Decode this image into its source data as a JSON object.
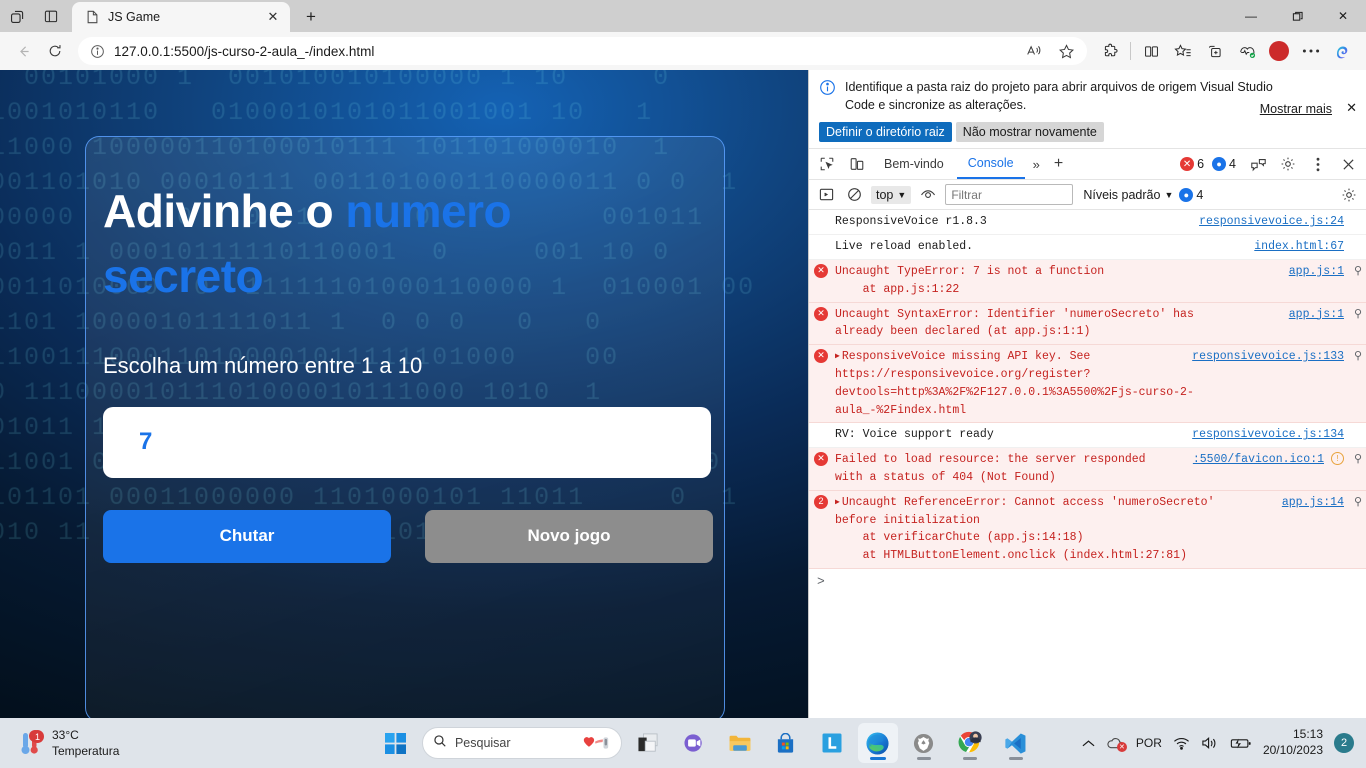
{
  "browser": {
    "tab": {
      "title": "JS Game",
      "favicon_icon": "page-icon",
      "close_icon": "close-icon"
    },
    "new_tab_label": "+",
    "tab_actions_icon": "tab-actions-icon",
    "tab_search_icon": "vertical-tabs-icon",
    "window_controls": {
      "minimize": "—",
      "maximize": "❐",
      "close": "✕"
    },
    "nav": {
      "back_icon": "back-arrow-icon",
      "reload_icon": "reload-icon",
      "url": "127.0.0.1:5500/js-curso-2-aula_-/index.html",
      "site_info_icon": "info-circle-icon",
      "read_aloud_icon": "read-aloud-icon",
      "favorite_icon": "star-icon",
      "extensions_icon": "puzzle-piece-icon",
      "split_screen_icon": "split-screen-icon",
      "collections_icon": "favorites-list-icon",
      "add_tab_group_icon": "browser-essentials-icon",
      "performance_icon": "browser-essentials-health-icon",
      "profile_icon": "profile-avatar-icon",
      "settings_more_icon": "more-options-icon",
      "copilot_icon": "copilot-icon"
    }
  },
  "game": {
    "title_part1": "Adivinhe o ",
    "title_accent": "numero secreto",
    "subtitle": "Escolha um número entre 1 a 10",
    "input_value": "7",
    "input_placeholder": "",
    "guess_button": "Chutar",
    "new_game_button": "Novo jogo",
    "accent_color": "#1a73e8",
    "secondary_color": "#8d8d8d",
    "binary_lines": [
      "  00101000 1  001010010100000 1 10     0",
      "1001010110   0100010101011001001 10   1",
      "11000 100000110100010111 101101000010  1",
      "001101010 00010111 001101000110000011 0 0  1",
      "00000      0   0  1      0          001011",
      "0011 1 00010111110110001  0     001 10 0",
      "0011010000  0  11111101000110000 1  010001 00",
      "1101 10000101111011 1  0 0 0   0   0",
      "1100111000110100001011111101000    00",
      "0 11100001011101000010111000 1010  1",
      "01011 1 0101110100010111 0100 1 0 10  11",
      "11001 00 01101 0001011001011000010 00     0",
      "101101 00011000000 1101000101 11011     0  1",
      "010 11 101101000 101100101 010 011000   0"
    ]
  },
  "devtools": {
    "banner": {
      "icon": "info-circle-icon",
      "text": "Identifique a pasta raiz do projeto para abrir arquivos de origem Visual Studio Code e sincronize as alterações.",
      "show_more": "Mostrar mais",
      "close_icon": "close-icon",
      "primary_button": "Definir o diretório raiz",
      "secondary_button": "Não mostrar novamente"
    },
    "toolbar": {
      "inspect_icon": "inspect-element-icon",
      "device_toggle_icon": "device-emulation-icon",
      "tabs": [
        {
          "label": "Bem-vindo",
          "active": false
        },
        {
          "label": "Console",
          "active": true
        }
      ],
      "more_tabs_icon": "chevron-double-right-icon",
      "add_tab_icon": "plus-icon",
      "error_count": "6",
      "info_count": "4",
      "issues_icon": "issues-icon",
      "settings_icon": "gear-icon",
      "more_icon": "more-vertical-icon",
      "close_icon": "close-icon"
    },
    "filterbar": {
      "sidebar_icon": "console-sidebar-icon",
      "clear_icon": "clear-console-icon",
      "context": "top",
      "context_caret": "▼",
      "eye_icon": "live-expression-icon",
      "filter_placeholder": "Filtrar",
      "levels_label": "Níveis padrão",
      "levels_caret": "▼",
      "info_count": "4",
      "settings_icon": "gear-icon"
    },
    "messages": [
      {
        "type": "log",
        "text": "ResponsiveVoice r1.8.3",
        "source": "responsivevoice.js:24",
        "badge": null,
        "has_zoom": false
      },
      {
        "type": "log",
        "text": "Live reload enabled.",
        "source": "index.html:67",
        "badge": null,
        "has_zoom": false
      },
      {
        "type": "error",
        "text": "Uncaught TypeError: 7 is not a function",
        "line2_prefix": "    at ",
        "line2_link": "app.js:1:22",
        "source": "app.js:1",
        "badge": "x",
        "has_zoom": true
      },
      {
        "type": "error",
        "text": "Uncaught SyntaxError: Identifier 'numeroSecreto' has already been declared (at ",
        "line2_link": "app.js:1:1",
        "text_suffix": ")",
        "source": "app.js:1",
        "badge": "x",
        "has_zoom": true
      },
      {
        "type": "error",
        "text": "ResponsiveVoice missing API key. See ",
        "link": "https://responsivevoice.org/register?devtools=http%3A%2F%2F127.0.0.1%3A5500%2Fjs-curso-2-aula_-%2Findex.html",
        "source": "responsivevoice.js:133",
        "badge": "x",
        "expandable": true,
        "has_zoom": true
      },
      {
        "type": "log",
        "text": "RV: Voice support ready",
        "source": "responsivevoice.js:134",
        "badge": null,
        "has_zoom": false
      },
      {
        "type": "error",
        "text": "Failed to load resource: the server responded with a status of 404 (Not Found)",
        "source": ":5500/favicon.ico:1",
        "badge": "x",
        "has_warning_icon": true,
        "has_zoom": true
      },
      {
        "type": "error",
        "text": "Uncaught ReferenceError: Cannot access 'numeroSecreto' before initialization",
        "stack1_prefix": "    at verificarChute (",
        "stack1_link": "app.js:14:18",
        "stack2_prefix": "    at HTMLButtonElement.onclick (",
        "stack2_link": "index.html:27:81",
        "source": "app.js:14",
        "badge": "2",
        "expandable": true,
        "has_zoom": true
      }
    ],
    "prompt_symbol": ">"
  },
  "taskbar": {
    "weather": {
      "temperature": "33°C",
      "label": "Temperatura",
      "icon": "thermometer-icon",
      "badge": "1"
    },
    "start_icon": "windows-start-icon",
    "search_placeholder": "Pesquisar",
    "search_icon": "search-icon",
    "apps": [
      {
        "name": "task-view-icon",
        "active": false,
        "indicator": false
      },
      {
        "name": "microsoft-teams-icon",
        "active": false,
        "indicator": false
      },
      {
        "name": "file-explorer-icon",
        "active": false,
        "indicator": false
      },
      {
        "name": "microsoft-store-icon",
        "active": false,
        "indicator": false
      },
      {
        "name": "lastpass-icon",
        "active": false,
        "indicator": false
      },
      {
        "name": "microsoft-edge-icon",
        "active": true,
        "indicator": true
      },
      {
        "name": "brave-browser-icon",
        "active": false,
        "indicator": true
      },
      {
        "name": "google-chrome-icon",
        "active": false,
        "indicator": true
      },
      {
        "name": "vs-code-icon",
        "active": false,
        "indicator": true
      }
    ],
    "tray": {
      "overflow_icon": "chevron-up-icon",
      "onedrive_icon": "onedrive-error-icon",
      "language": "POR",
      "wifi_icon": "wifi-icon",
      "volume_icon": "volume-icon",
      "battery_icon": "battery-charging-icon",
      "time": "15:13",
      "date": "20/10/2023",
      "notification_count": "2"
    }
  }
}
